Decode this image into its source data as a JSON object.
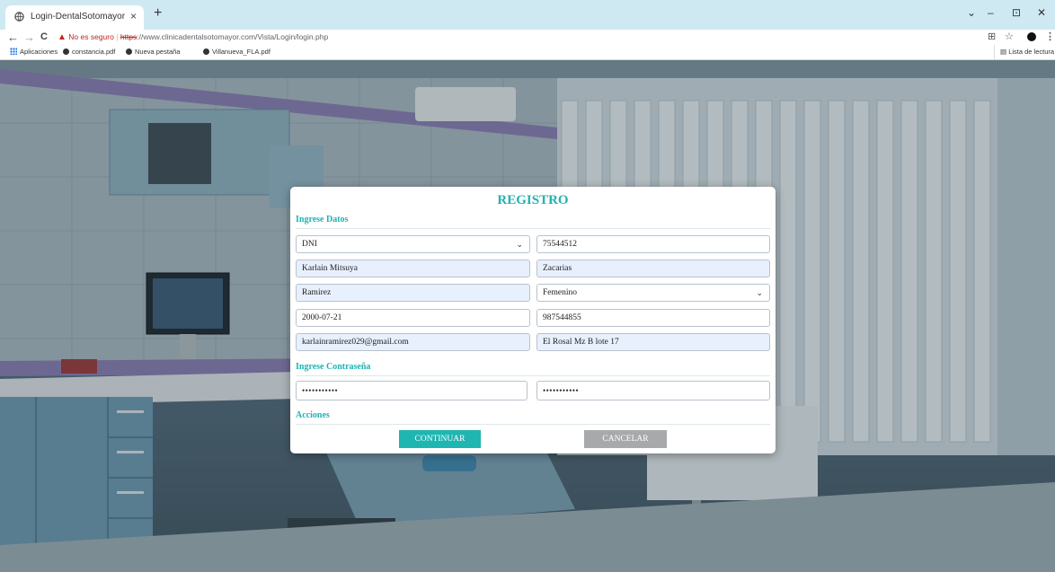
{
  "browser": {
    "tab_title": "Login-DentalSotomayor",
    "tab_close": "×",
    "new_tab": "+",
    "window_controls": {
      "minimize": "–",
      "maximize": "⊡",
      "close": "✕",
      "tabsearch": "⌄"
    },
    "nav": {
      "back": "←",
      "forward": "→",
      "reload": "C"
    },
    "omnibox": {
      "warning_icon": "▲",
      "security_text": "No es seguro",
      "separator": "|",
      "scheme": "https",
      "url_rest": "://www.clinicadentalsotomayor.com/Vista/Login/login.php"
    },
    "right_icons": {
      "translate": "⊞",
      "bookmark_star": "☆",
      "menu": "⋮"
    },
    "bookmarks": [
      {
        "label": "Aplicaciones",
        "icon": "apps-grid-icon"
      },
      {
        "label": "constancia.pdf",
        "icon": "globe-icon"
      },
      {
        "label": "Nueva pestaña",
        "icon": "globe-icon"
      },
      {
        "label": "Villanueva_FLA.pdf",
        "icon": "globe-icon"
      }
    ],
    "reading_list": "Lista de lectura",
    "reading_list_icon": "▤"
  },
  "form": {
    "title": "REGISTRO",
    "section_data": "Ingrese Datos",
    "doc_type": "DNI",
    "doc_number": "75544512",
    "first_name": "Karlain Mitsuya",
    "last_name_1": "Zacarias",
    "last_name_2": "Ramirez",
    "gender": "Femenino",
    "birth_date": "2000-07-21",
    "phone": "987544855",
    "email": "karlainramirez029@gmail.com",
    "address": "El Rosal Mz B lote 17",
    "section_password": "Ingrese Contraseña",
    "password": "•••••••••••",
    "password_confirm": "•••••••••••",
    "section_actions": "Acciones",
    "continue_label": "CONTINUAR",
    "cancel_label": "CANCELAR",
    "select_chevron": "⌄"
  },
  "colors": {
    "accent": "#1fb3b3",
    "primary_button": "#1fb6b2",
    "secondary_button": "#a7a9ab",
    "autofill": "#e8f0fe",
    "insecure": "#c5221f"
  }
}
